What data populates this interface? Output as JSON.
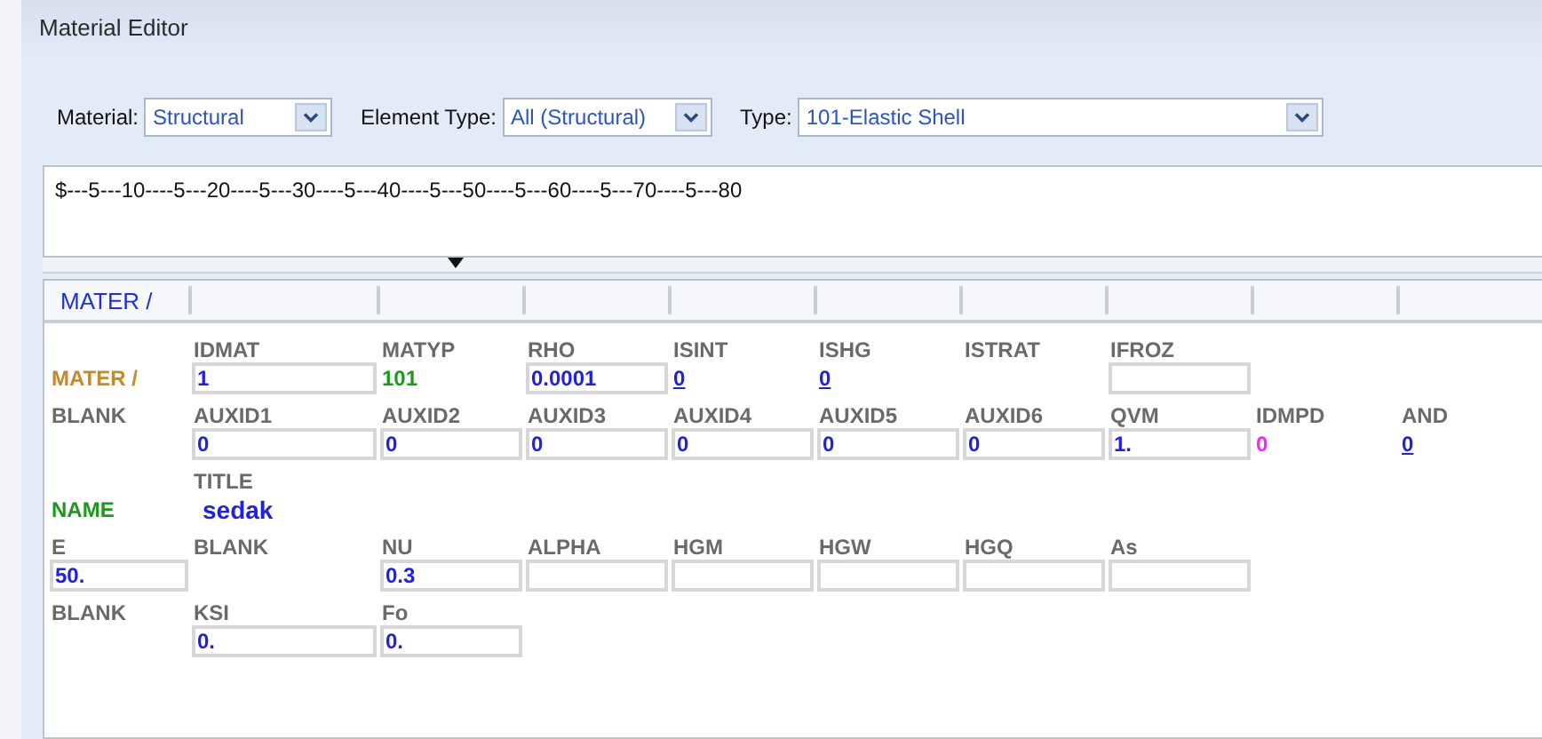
{
  "window": {
    "title": "Material Editor"
  },
  "toolbar": [
    {
      "label": "Material:",
      "value": "Structural"
    },
    {
      "label": "Element Type:",
      "value": "All (Structural)"
    },
    {
      "label": "Type:",
      "value": "101-Elastic Shell"
    }
  ],
  "ruler": "$---5---10----5---20----5---30----5---40----5---50----5---60----5---70----5---80",
  "card_tab": "MATER /",
  "rows": [
    [
      {
        "kind": "empty"
      },
      {
        "kind": "name",
        "text": "IDMAT"
      },
      {
        "kind": "name",
        "text": "MATYP"
      },
      {
        "kind": "name",
        "text": "RHO"
      },
      {
        "kind": "name",
        "text": "ISINT"
      },
      {
        "kind": "name",
        "text": "ISHG"
      },
      {
        "kind": "name",
        "text": "ISTRAT"
      },
      {
        "kind": "name",
        "text": "IFROZ"
      }
    ],
    [
      {
        "kind": "card",
        "text": "MATER /",
        "color": "#c8882a"
      },
      {
        "kind": "field",
        "text": "1"
      },
      {
        "kind": "plain",
        "text": "101",
        "color": "#1a9a1a"
      },
      {
        "kind": "field",
        "text": "0.0001"
      },
      {
        "kind": "link",
        "text": "0"
      },
      {
        "kind": "link",
        "text": "0"
      },
      {
        "kind": "empty"
      },
      {
        "kind": "field"
      }
    ],
    [
      {
        "kind": "name",
        "text": "BLANK"
      },
      {
        "kind": "name",
        "text": "AUXID1"
      },
      {
        "kind": "name",
        "text": "AUXID2"
      },
      {
        "kind": "name",
        "text": "AUXID3"
      },
      {
        "kind": "name",
        "text": "AUXID4"
      },
      {
        "kind": "name",
        "text": "AUXID5"
      },
      {
        "kind": "name",
        "text": "AUXID6"
      },
      {
        "kind": "name",
        "text": "QVM"
      },
      {
        "kind": "name",
        "text": "IDMPD"
      },
      {
        "kind": "name",
        "text": "AND"
      }
    ],
    [
      {
        "kind": "empty"
      },
      {
        "kind": "field",
        "text": "0"
      },
      {
        "kind": "field",
        "text": "0"
      },
      {
        "kind": "field",
        "text": "0"
      },
      {
        "kind": "field",
        "text": "0"
      },
      {
        "kind": "field",
        "text": "0"
      },
      {
        "kind": "field",
        "text": "0"
      },
      {
        "kind": "field",
        "text": "1."
      },
      {
        "kind": "plain",
        "text": "0",
        "color": "#ff20ff"
      },
      {
        "kind": "link",
        "text": "0"
      }
    ],
    [
      {
        "kind": "empty"
      },
      {
        "kind": "name",
        "text": "TITLE"
      }
    ],
    [
      {
        "kind": "card",
        "text": "NAME",
        "color": "#1a9a1a"
      },
      {
        "kind": "title",
        "text": "sedak"
      }
    ],
    [
      {
        "kind": "name",
        "text": "E"
      },
      {
        "kind": "name",
        "text": "BLANK"
      },
      {
        "kind": "name",
        "text": "NU"
      },
      {
        "kind": "name",
        "text": "ALPHA"
      },
      {
        "kind": "name",
        "text": "HGM"
      },
      {
        "kind": "name",
        "text": "HGW"
      },
      {
        "kind": "name",
        "text": "HGQ"
      },
      {
        "kind": "name",
        "text": "As"
      }
    ],
    [
      {
        "kind": "field",
        "text": "50."
      },
      {
        "kind": "empty"
      },
      {
        "kind": "field",
        "text": "0.3"
      },
      {
        "kind": "field"
      },
      {
        "kind": "field"
      },
      {
        "kind": "field"
      },
      {
        "kind": "field"
      },
      {
        "kind": "field"
      }
    ],
    [
      {
        "kind": "name",
        "text": "BLANK"
      },
      {
        "kind": "name",
        "text": "KSI"
      },
      {
        "kind": "name",
        "text": "Fo"
      }
    ],
    [
      {
        "kind": "empty"
      },
      {
        "kind": "field",
        "text": "0."
      },
      {
        "kind": "field",
        "text": "0."
      }
    ]
  ]
}
